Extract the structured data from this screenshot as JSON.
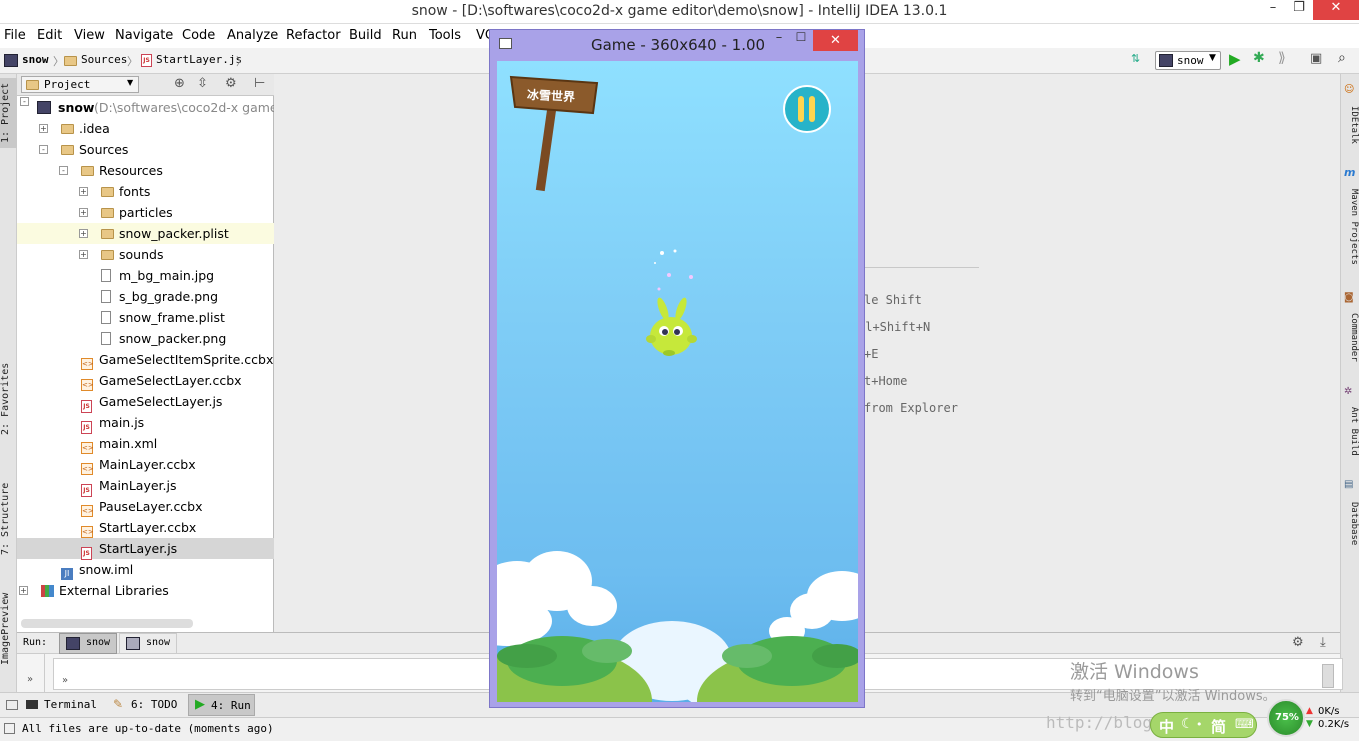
{
  "window": {
    "title": "snow - [D:\\softwares\\coco2d-x game editor\\demo\\snow] - IntelliJ IDEA 13.0.1",
    "minimize": "–",
    "maximize": "❐",
    "close": "✕"
  },
  "menu": [
    "File",
    "Edit",
    "View",
    "Navigate",
    "Code",
    "Analyze",
    "Refactor",
    "Build",
    "Run",
    "Tools",
    "VC"
  ],
  "breadcrumb": {
    "root": "snow",
    "folder": "Sources",
    "file": "StartLayer.js"
  },
  "toolbar": {
    "run_config": "snow"
  },
  "left_tabs": {
    "project": "1: Project",
    "favorites": "2: Favorites",
    "structure": "7: Structure",
    "imagepreview": "ImagePreview"
  },
  "project": {
    "header": "Project",
    "root_name": "snow",
    "root_path": "(D:\\softwares\\coco2d-x game e",
    "tree": [
      {
        "label": ".idea",
        "icon": "folder",
        "depth": 1,
        "expander": "+"
      },
      {
        "label": "Sources",
        "icon": "folder",
        "depth": 1,
        "expander": "-"
      },
      {
        "label": "Resources",
        "icon": "folder",
        "depth": 2,
        "expander": "-"
      },
      {
        "label": "fonts",
        "icon": "folder",
        "depth": 3,
        "expander": "+"
      },
      {
        "label": "particles",
        "icon": "folder",
        "depth": 3,
        "expander": "+"
      },
      {
        "label": "snow_packer.plist",
        "icon": "folder",
        "depth": 3,
        "expander": "+",
        "highlight": true
      },
      {
        "label": "sounds",
        "icon": "folder",
        "depth": 3,
        "expander": "+"
      },
      {
        "label": "m_bg_main.jpg",
        "icon": "file",
        "depth": 3
      },
      {
        "label": "s_bg_grade.png",
        "icon": "file",
        "depth": 3
      },
      {
        "label": "snow_frame.plist",
        "icon": "file",
        "depth": 3
      },
      {
        "label": "snow_packer.png",
        "icon": "file",
        "depth": 3
      },
      {
        "label": "GameSelectItemSprite.ccbx",
        "icon": "ccbx",
        "depth": 2
      },
      {
        "label": "GameSelectLayer.ccbx",
        "icon": "ccbx",
        "depth": 2
      },
      {
        "label": "GameSelectLayer.js",
        "icon": "js",
        "depth": 2
      },
      {
        "label": "main.js",
        "icon": "js",
        "depth": 2
      },
      {
        "label": "main.xml",
        "icon": "ccbx",
        "depth": 2
      },
      {
        "label": "MainLayer.ccbx",
        "icon": "ccbx",
        "depth": 2
      },
      {
        "label": "MainLayer.js",
        "icon": "js",
        "depth": 2
      },
      {
        "label": "PauseLayer.ccbx",
        "icon": "ccbx",
        "depth": 2
      },
      {
        "label": "StartLayer.ccbx",
        "icon": "ccbx",
        "depth": 2
      },
      {
        "label": "StartLayer.js",
        "icon": "js",
        "depth": 2,
        "selected": true
      },
      {
        "label": "snow.iml",
        "icon": "iml",
        "depth": 1
      },
      {
        "label": "External Libraries",
        "icon": "lib",
        "depth": 0,
        "expander": "+"
      }
    ]
  },
  "editor_hints": [
    "le Shift",
    "rl+Shift+N",
    "+E",
    "t+Home",
    "from Explorer"
  ],
  "right_tabs": [
    "IDEtalk",
    "Maven Projects",
    "Commander",
    "Ant Build",
    "Database"
  ],
  "run": {
    "label": "Run:",
    "tab1": "snow",
    "tab2": "snow"
  },
  "bottom_tabs": {
    "terminal": "Terminal",
    "todo": "6: TODO",
    "run": "4: Run"
  },
  "status": {
    "message": "All files are up-to-date (moments ago)"
  },
  "game": {
    "title": "Game - 360x640 - 1.00",
    "sign_text": "冰雪世界",
    "pause_icon": "pause-icon"
  },
  "overlay": {
    "activate_title": "激活 Windows",
    "activate_sub": "转到“电脑设置”以激活 Windows。",
    "blog": "http://blog.csdn",
    "ime": "中",
    "ime2": "简",
    "cpu": "75%",
    "net_up": "0K/s",
    "net_down": "0.2K/s"
  },
  "colors": {
    "accent": "#4a7dc0",
    "game_frame": "#a9a2e8",
    "sky_top": "#8fe0ff",
    "selected_row": "#d6d6d6"
  }
}
